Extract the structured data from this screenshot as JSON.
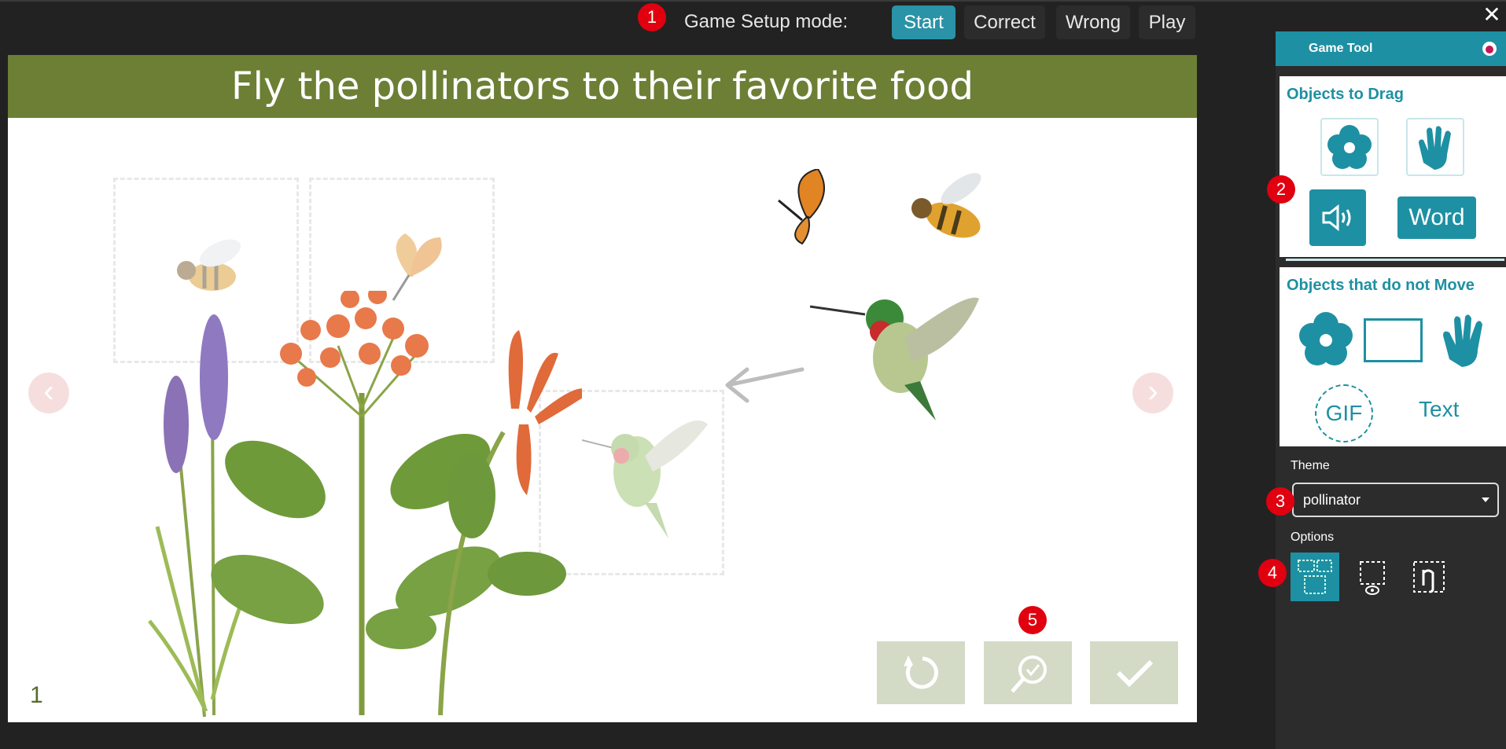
{
  "window": {
    "close_icon": "close-icon"
  },
  "mode_bar": {
    "label": "Game Setup mode:",
    "buttons": [
      "Start",
      "Correct",
      "Wrong",
      "Play"
    ],
    "active": "Start"
  },
  "badges": [
    "1",
    "2",
    "3",
    "4",
    "5"
  ],
  "stage": {
    "title": "Fly the pollinators to their favorite food",
    "page_number": "1",
    "title_bg": "#6c7f34"
  },
  "controls": [
    "reset-icon",
    "check-answer-icon",
    "checkmark-icon"
  ],
  "panel": {
    "title": "Game Tool",
    "accent": "#1e90a3",
    "drag_section": {
      "title": "Objects to Drag",
      "word_label": "Word"
    },
    "static_section": {
      "title": "Objects that do not Move",
      "gif_label": "GIF",
      "text_label": "Text"
    },
    "theme_label": "Theme",
    "theme_value": "pollinator",
    "options_label": "Options"
  }
}
